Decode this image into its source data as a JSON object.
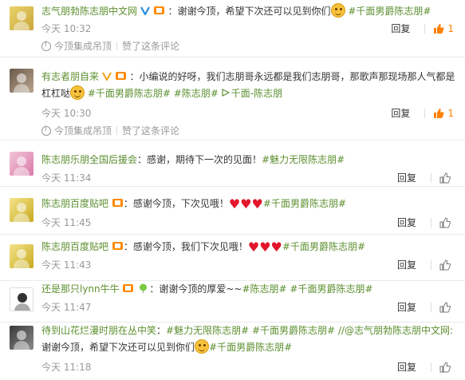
{
  "comments": [
    {
      "user": "志气朋勃陈志朋中文网",
      "text_before": "：谢谢今顶，希望下次还可以见到你们",
      "tags": [
        "#千面男爵陈志朋#"
      ],
      "time": "今天 10:32",
      "reply": "回复",
      "likes": "1",
      "liked": true,
      "subline": [
        "今顶集成吊顶",
        "赞了这条评论"
      ]
    },
    {
      "user": "有志者朋自来",
      "text_before": "：小编说的好呀，我们志朋哥永远都是我们志朋哥，那歌声那现场那人气都是杠杠哒",
      "tags": [
        "#千面男爵陈志朋#",
        "#陈志朋#"
      ],
      "video": "千面-陈志朋",
      "time": "今天 10:30",
      "reply": "回复",
      "likes": "1",
      "liked": true,
      "subline": [
        "今顶集成吊顶",
        "赞了这条评论"
      ]
    },
    {
      "user": "陈志朋乐朋全国后援会",
      "text_before": "：感谢，期待下一次的见面！",
      "tags": [
        "#魅力无限陈志朋#"
      ],
      "time": "今天 11:34",
      "reply": "回复",
      "likes": "",
      "liked": false
    },
    {
      "user": "陈志朋百度贴吧",
      "text_before": "：感谢今顶，下次见哦！",
      "hearts": 3,
      "tags": [
        "#千面男爵陈志朋#"
      ],
      "time": "今天 11:45",
      "reply": "回复",
      "likes": "",
      "liked": false
    },
    {
      "user": "陈志朋百度贴吧",
      "text_before": "：感谢今顶，我们下次见哦！",
      "hearts": 3,
      "tags": [
        "#千面男爵陈志朋#"
      ],
      "time": "今天 11:43",
      "reply": "回复",
      "likes": "",
      "liked": false
    },
    {
      "user": "还是那只lynn牛牛",
      "text_before": "：谢谢今顶的厚爱~~",
      "tags": [
        "#陈志朋#",
        "#千面男爵陈志朋#"
      ],
      "time": "今天 11:47",
      "reply": "回复",
      "likes": "",
      "liked": false
    },
    {
      "user": "待到山花烂漫时朋在丛中笑",
      "text_before": "：",
      "tags": [
        "#魅力无限陈志朋#",
        "#千面男爵陈志朋#"
      ],
      "repost": "//@志气朋勃陈志朋中文网:",
      "text_after": "谢谢今顶，希望下次还可以见到你们",
      "tail_tag": "#千面男爵陈志朋#",
      "time": "今天 11:18",
      "reply": "回复",
      "likes": "",
      "liked": false
    }
  ],
  "colors": {
    "link_green": "#5c8f2f",
    "like_orange": "#ff8200",
    "meta_gray": "#999999",
    "heart_red": "#e2162b"
  }
}
